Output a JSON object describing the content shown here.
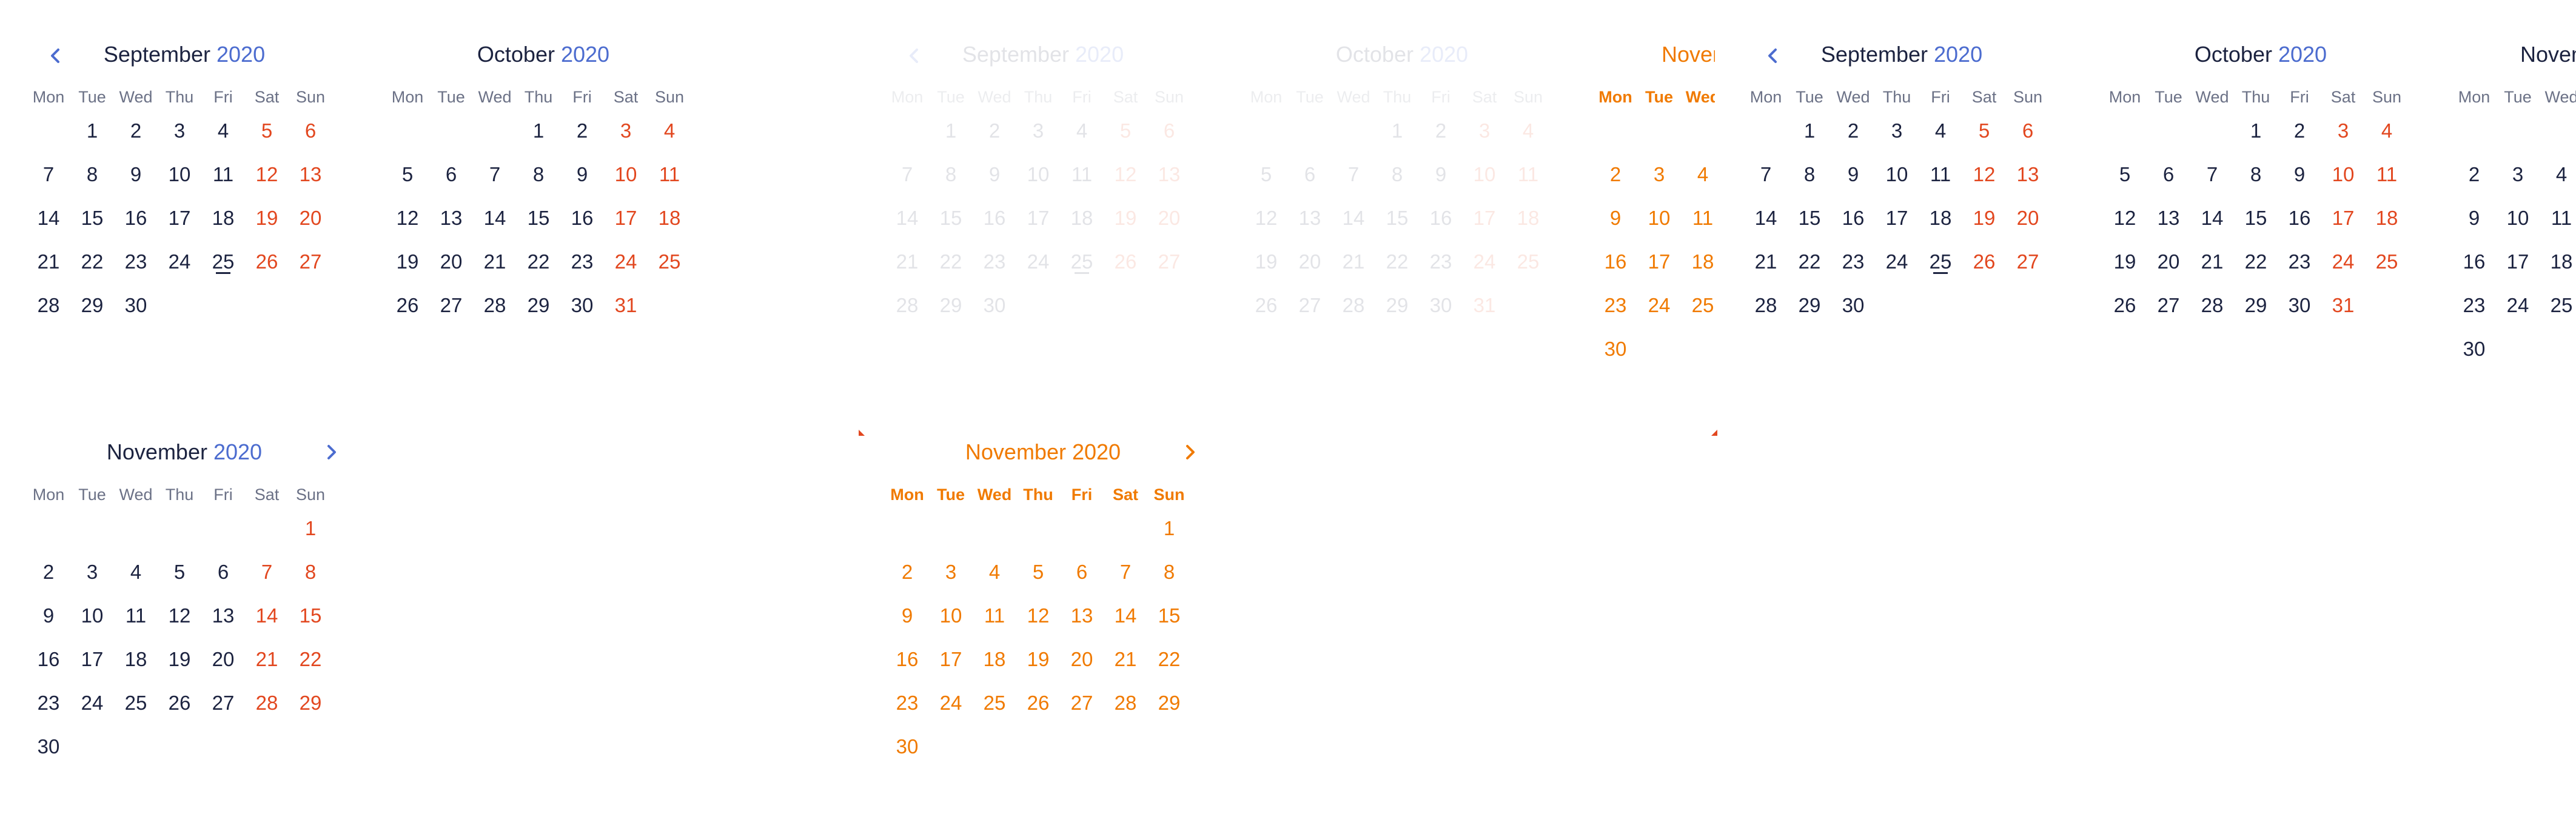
{
  "months": {
    "sep": {
      "name": "September",
      "year": "2020",
      "lead": 1,
      "days": 30
    },
    "oct": {
      "name": "October",
      "year": "2020",
      "lead": 3,
      "days": 31
    },
    "nov": {
      "name": "November",
      "year": "2020",
      "lead": 6,
      "days": 30
    }
  },
  "weekdays": [
    "Mon",
    "Tue",
    "Wed",
    "Thu",
    "Fri",
    "Sat",
    "Sun"
  ],
  "today": 25,
  "colors": {
    "text": "#1c2340",
    "year": "#4c6ccf",
    "weekend": "#e2471f",
    "highlight": "#f07a00",
    "muted": "#6b7186"
  },
  "icons": {
    "prev": "chevron-left-icon",
    "next": "chevron-right-icon"
  }
}
